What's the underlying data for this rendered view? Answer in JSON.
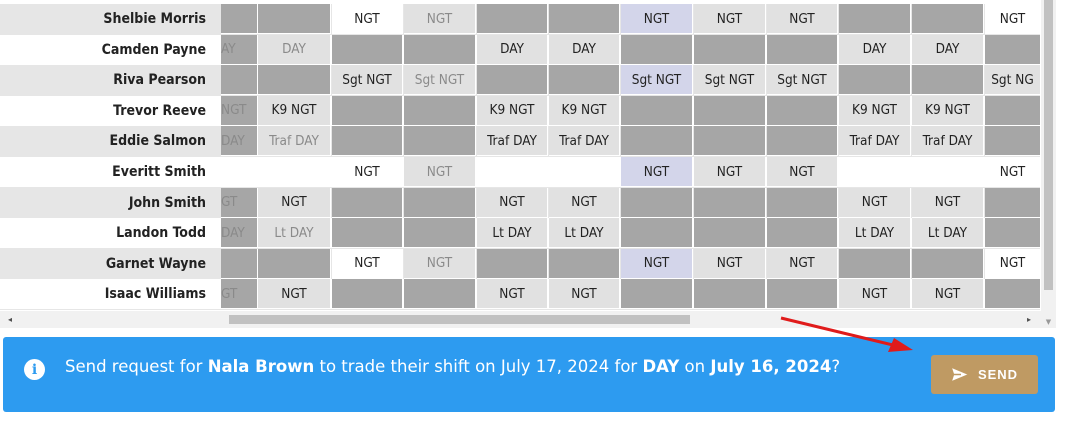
{
  "schedule": {
    "rows": [
      {
        "name": "Shelbie Morris",
        "cells": [
          "",
          "",
          "NGT",
          "NGT",
          "",
          "",
          "NGT",
          "NGT",
          "NGT",
          "",
          "",
          "NGT"
        ]
      },
      {
        "name": "Camden Payne",
        "cells": [
          "AY",
          "DAY",
          "",
          "",
          "DAY",
          "DAY",
          "",
          "",
          "",
          "DAY",
          "DAY",
          ""
        ]
      },
      {
        "name": "Riva Pearson",
        "cells": [
          "",
          "",
          "Sgt NGT",
          "Sgt NGT",
          "",
          "",
          "Sgt NGT",
          "Sgt NGT",
          "Sgt NGT",
          "",
          "",
          "Sgt NG"
        ]
      },
      {
        "name": "Trevor Reeve",
        "cells": [
          "NGT",
          "K9 NGT",
          "",
          "",
          "K9 NGT",
          "K9 NGT",
          "",
          "",
          "",
          "K9 NGT",
          "K9 NGT",
          ""
        ]
      },
      {
        "name": "Eddie Salmon",
        "cells": [
          "DAY",
          "Traf DAY",
          "",
          "",
          "Traf DAY",
          "Traf DAY",
          "",
          "",
          "",
          "Traf DAY",
          "Traf DAY",
          ""
        ]
      },
      {
        "name": "Everitt Smith",
        "cells": [
          "",
          "",
          "NGT",
          "NGT",
          "",
          "",
          "NGT",
          "NGT",
          "NGT",
          "",
          "",
          "NGT"
        ]
      },
      {
        "name": "John Smith",
        "cells": [
          "GT",
          "NGT",
          "",
          "",
          "NGT",
          "NGT",
          "",
          "",
          "",
          "NGT",
          "NGT",
          ""
        ]
      },
      {
        "name": "Landon Todd",
        "cells": [
          "DAY",
          "Lt DAY",
          "",
          "",
          "Lt DAY",
          "Lt DAY",
          "",
          "",
          "",
          "Lt DAY",
          "Lt DAY",
          ""
        ]
      },
      {
        "name": "Garnet Wayne",
        "cells": [
          "",
          "",
          "NGT",
          "NGT",
          "",
          "",
          "NGT",
          "NGT",
          "NGT",
          "",
          "",
          "NGT"
        ]
      },
      {
        "name": "Isaac Williams",
        "cells": [
          "GT",
          "NGT",
          "",
          "",
          "NGT",
          "NGT",
          "",
          "",
          "",
          "NGT",
          "NGT",
          ""
        ]
      }
    ]
  },
  "banner": {
    "prefix": "Send request for ",
    "person": "Nala Brown",
    "mid1": " to trade their shift on July 17, 2024 for ",
    "shift": "DAY",
    "mid2": " on ",
    "date": "July 16, 2024",
    "suffix": "?",
    "send_label": "SEND",
    "info_icon": "i"
  },
  "scrollbar": {
    "left_arrow": "◂",
    "right_arrow": "▸",
    "down_arrow": "▼"
  },
  "colors": {
    "banner_bg": "#2d9bf0",
    "send_button": "#bf9a63",
    "annotation_arrow": "#e01b1b",
    "cell_gray": "#a6a6a6",
    "cell_light": "#e1e1e1",
    "cell_white": "#ffffff",
    "cell_lavender": "#d3d5ea"
  }
}
